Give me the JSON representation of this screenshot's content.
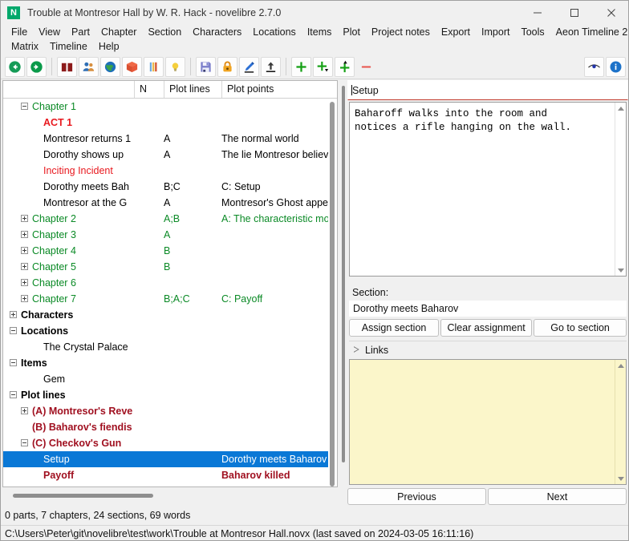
{
  "window": {
    "app_icon": "N",
    "title": "Trouble at Montresor Hall by W. R. Hack - novelibre 2.7.0",
    "minimize_label": "minimize-icon",
    "maximize_label": "maximize-icon",
    "close_label": "close-icon"
  },
  "menubar": {
    "row1": [
      "File",
      "View",
      "Part",
      "Chapter",
      "Section",
      "Characters",
      "Locations",
      "Items",
      "Plot",
      "Project notes",
      "Export",
      "Import",
      "Tools",
      "Aeon Timeline 2"
    ],
    "row2": [
      "Matrix",
      "Timeline",
      "Help"
    ]
  },
  "toolbar": {
    "buttons": [
      {
        "name": "go-back-icon",
        "title": "Go back"
      },
      {
        "name": "go-forward-icon",
        "title": "Go forward"
      },
      {
        "name": "book-icon",
        "title": "Book"
      },
      {
        "name": "characters-icon",
        "title": "Characters"
      },
      {
        "name": "locations-globe-icon",
        "title": "Locations"
      },
      {
        "name": "items-box-icon",
        "title": "Items"
      },
      {
        "name": "plot-lines-icon",
        "title": "Plot lines"
      },
      {
        "name": "project-notes-bulb-icon",
        "title": "Project notes"
      },
      {
        "name": "save-icon",
        "title": "Save"
      },
      {
        "name": "lock-icon",
        "title": "Lock"
      },
      {
        "name": "manuscript-pen-icon",
        "title": "Manuscript"
      },
      {
        "name": "export-up-icon",
        "title": "Export"
      },
      {
        "name": "add-child-icon",
        "title": "Add child"
      },
      {
        "name": "add-element-icon",
        "title": "Add element"
      },
      {
        "name": "add-parent-icon",
        "title": "Add parent"
      },
      {
        "name": "delete-icon",
        "title": "Delete"
      },
      {
        "name": "view-eye-icon",
        "title": "Toggle view"
      },
      {
        "name": "info-icon",
        "title": "Info"
      }
    ]
  },
  "tree": {
    "columns": [
      "",
      "N",
      "Plot lines",
      "Plot points"
    ],
    "rows": [
      {
        "indent": 1,
        "toggle": "minus",
        "title": "Chapter 1",
        "n": "",
        "plotlines": "",
        "plotpoints": "",
        "style": "green"
      },
      {
        "indent": 2,
        "toggle": "",
        "title": "ACT 1",
        "n": "",
        "plotlines": "",
        "plotpoints": "",
        "style": "red-bold"
      },
      {
        "indent": 2,
        "toggle": "",
        "title": "Montresor returns 1",
        "n": "",
        "plotlines": "A",
        "plotpoints": "The normal world",
        "style": "black"
      },
      {
        "indent": 2,
        "toggle": "",
        "title": "Dorothy shows up",
        "n": "",
        "plotlines": "A",
        "plotpoints": "The lie Montresor believes",
        "style": "black"
      },
      {
        "indent": 2,
        "toggle": "",
        "title": "Inciting Incident",
        "n": "",
        "plotlines": "",
        "plotpoints": "",
        "style": "red"
      },
      {
        "indent": 2,
        "toggle": "",
        "title": "Dorothy meets Bah",
        "n": "",
        "plotlines": "B;C",
        "plotpoints": "C: Setup",
        "style": "black"
      },
      {
        "indent": 2,
        "toggle": "",
        "title": "Montresor at the G",
        "n": "",
        "plotlines": "A",
        "plotpoints": "Montresor's Ghost appears",
        "style": "black"
      },
      {
        "indent": 1,
        "toggle": "plus",
        "title": "Chapter 2",
        "n": "",
        "plotlines": "A;B",
        "plotpoints": "A: The characteristic mom",
        "style": "green"
      },
      {
        "indent": 1,
        "toggle": "plus",
        "title": "Chapter 3",
        "n": "",
        "plotlines": "A",
        "plotpoints": "",
        "style": "green"
      },
      {
        "indent": 1,
        "toggle": "plus",
        "title": "Chapter 4",
        "n": "",
        "plotlines": "B",
        "plotpoints": "",
        "style": "green"
      },
      {
        "indent": 1,
        "toggle": "plus",
        "title": "Chapter 5",
        "n": "",
        "plotlines": "B",
        "plotpoints": "",
        "style": "green"
      },
      {
        "indent": 1,
        "toggle": "plus",
        "title": "Chapter 6",
        "n": "",
        "plotlines": "",
        "plotpoints": "",
        "style": "green"
      },
      {
        "indent": 1,
        "toggle": "plus",
        "title": "Chapter 7",
        "n": "",
        "plotlines": "B;A;C",
        "plotpoints": "C: Payoff",
        "style": "green"
      },
      {
        "indent": 0,
        "toggle": "plus",
        "title": "Characters",
        "n": "",
        "plotlines": "",
        "plotpoints": "",
        "style": "black-bold"
      },
      {
        "indent": 0,
        "toggle": "minus",
        "title": "Locations",
        "n": "",
        "plotlines": "",
        "plotpoints": "",
        "style": "black-bold"
      },
      {
        "indent": 2,
        "toggle": "",
        "title": "The Crystal Palace",
        "n": "",
        "plotlines": "",
        "plotpoints": "",
        "style": "black"
      },
      {
        "indent": 0,
        "toggle": "minus",
        "title": "Items",
        "n": "",
        "plotlines": "",
        "plotpoints": "",
        "style": "black-bold"
      },
      {
        "indent": 2,
        "toggle": "",
        "title": "Gem",
        "n": "",
        "plotlines": "",
        "plotpoints": "",
        "style": "black"
      },
      {
        "indent": 0,
        "toggle": "minus",
        "title": "Plot lines",
        "n": "",
        "plotlines": "",
        "plotpoints": "",
        "style": "black-bold"
      },
      {
        "indent": 1,
        "toggle": "plus",
        "title": "(A) Montresor's Reve",
        "n": "",
        "plotlines": "",
        "plotpoints": "",
        "style": "dred"
      },
      {
        "indent": 1,
        "toggle": "",
        "title": "(B) Baharov's fiendis",
        "n": "",
        "plotlines": "",
        "plotpoints": "",
        "style": "dred"
      },
      {
        "indent": 1,
        "toggle": "minus",
        "title": "(C) Checkov's Gun",
        "n": "",
        "plotlines": "",
        "plotpoints": "",
        "style": "dred"
      },
      {
        "indent": 2,
        "toggle": "",
        "title": "Setup",
        "n": "",
        "plotlines": "",
        "plotpoints": "Dorothy meets Baharov",
        "style": "selected",
        "selected": true
      },
      {
        "indent": 2,
        "toggle": "",
        "title": "Payoff",
        "n": "",
        "plotlines": "",
        "plotpoints": "Baharov killed",
        "style": "dred"
      }
    ]
  },
  "right": {
    "element_title": "Setup",
    "description": "Baharoff walks into the room and\nnotices a rifle hanging on the wall.",
    "section_label": "Section:",
    "section_value": "Dorothy meets Baharov",
    "assign_section_label": "Assign section",
    "clear_assignment_label": "Clear assignment",
    "go_to_section_label": "Go to section",
    "links_label": "Links",
    "links_content": "",
    "previous_label": "Previous",
    "next_label": "Next"
  },
  "status": {
    "counts": "0 parts, 7 chapters, 24 sections, 69 words",
    "path": "C:\\Users\\Peter\\git\\novelibre\\test\\work\\Trouble at Montresor Hall.novx (last saved on 2024-03-05 16:11:16)"
  },
  "colors": {
    "selection": "#0a78d6",
    "chapter_green": "#0b8a26",
    "stage_red": "#e8191f",
    "plotline_dark_red": "#a01020",
    "links_bg": "#fbf6ca",
    "title_underline": "#c0392b"
  }
}
